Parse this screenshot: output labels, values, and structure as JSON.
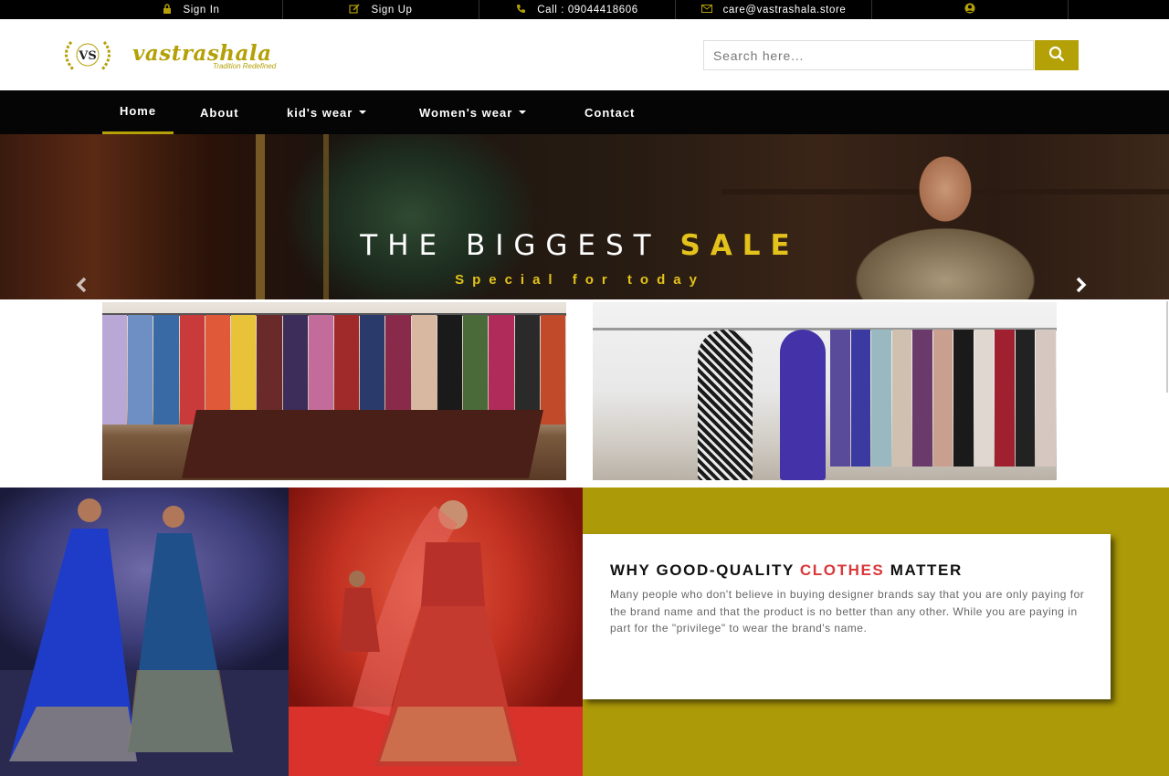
{
  "topbar": {
    "signin": "Sign In",
    "signup": "Sign Up",
    "call": "Call : 09044418606",
    "email": "care@vastrashala.store"
  },
  "header": {
    "brand_name": "vastrashala",
    "tagline": "Tradition Redefined",
    "logo_initials": "VS",
    "search_placeholder": "Search here..."
  },
  "nav": {
    "items": [
      {
        "label": "Home"
      },
      {
        "label": "About"
      },
      {
        "label": "kid's wear"
      },
      {
        "label": "Women's wear"
      },
      {
        "label": "Contact"
      }
    ]
  },
  "hero": {
    "title_prefix": "THE BIGGEST",
    "title_highlight": "SALE",
    "subtitle": "Special for today"
  },
  "promo": {
    "title_prefix": "WHY GOOD-QUALITY",
    "title_accent": "CLOTHES",
    "title_suffix": "MATTER",
    "body": "Many people who don't believe in buying designer brands say that you are only paying for the brand name and that the product is no better than any other. While you are paying in part for the \"privilege\" to wear the brand's name."
  },
  "colors": {
    "accent": "#b4a007",
    "highlight": "#e3c21b",
    "promo_accent": "#d9383a",
    "nav_bg": "#050505"
  },
  "icons": [
    "lock-icon",
    "edit-icon",
    "phone-icon",
    "envelope-icon",
    "user-icon",
    "search-icon",
    "chevron-left-icon",
    "chevron-right-icon"
  ]
}
